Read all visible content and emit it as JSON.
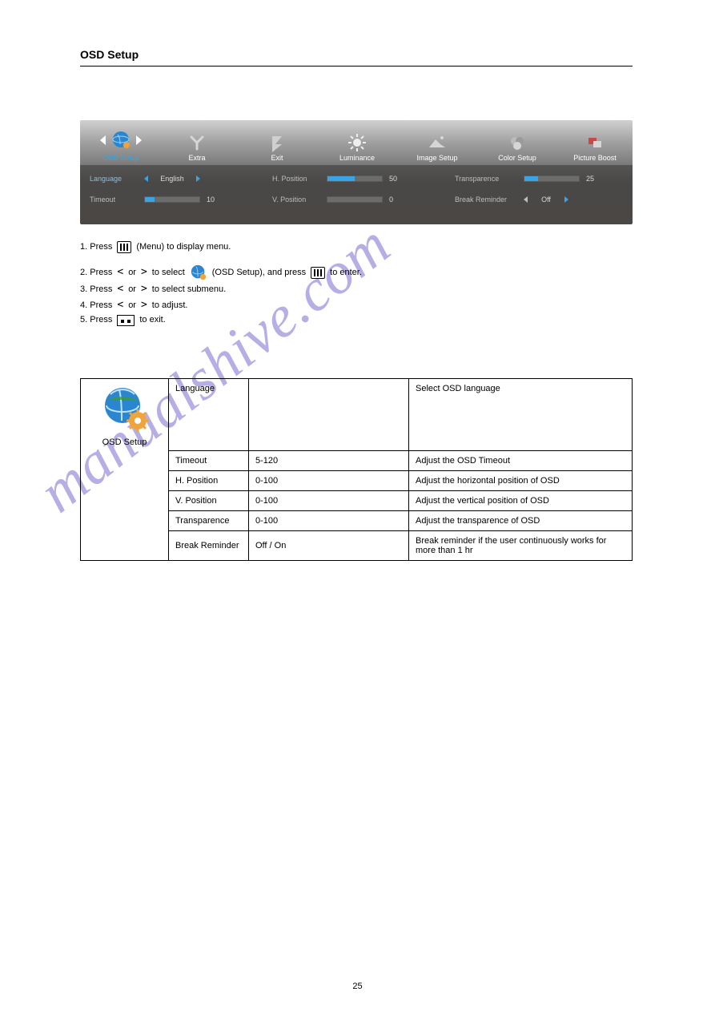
{
  "section_title": "OSD Setup",
  "osd": {
    "tabs": [
      {
        "label": "OSD Setup"
      },
      {
        "label": "Extra"
      },
      {
        "label": "Exit"
      },
      {
        "label": "Luminance"
      },
      {
        "label": "Image Setup"
      },
      {
        "label": "Color Setup"
      },
      {
        "label": "Picture Boost"
      }
    ],
    "language": {
      "label": "Language",
      "value": "English"
    },
    "timeout": {
      "label": "Timeout",
      "value": "10"
    },
    "hpos": {
      "label": "H. Position",
      "value": "50"
    },
    "vpos": {
      "label": "V. Position",
      "value": "0"
    },
    "transp": {
      "label": "Transparence",
      "value": "25"
    },
    "break": {
      "label": "Break Reminder",
      "value": "Off"
    }
  },
  "instructions": {
    "step1_a": "1.    Press",
    "step1_b": "(Menu) to display menu.",
    "step2_a": "2.    Press",
    "step2_or": "or",
    "step2_b": "to select",
    "step2_c": "(OSD Setup), and press",
    "step2_d": "to enter.",
    "step3_a": "3.    Press",
    "step3_b": "to select submenu.",
    "step4_a": "4.    Press",
    "step4_b": "to adjust.",
    "step5_a": "5.    Press",
    "step5_b": "to exit."
  },
  "table": {
    "icon_label": "OSD Setup",
    "rows": [
      {
        "name": "Language",
        "opts": "",
        "desc": "Select OSD language"
      },
      {
        "name": "Timeout",
        "opts": "5-120",
        "desc": "Adjust the OSD Timeout"
      },
      {
        "name": "H. Position",
        "opts": "0-100",
        "desc": "Adjust the horizontal position of OSD"
      },
      {
        "name": "V. Position",
        "opts": "0-100",
        "desc": "Adjust the vertical position of OSD"
      },
      {
        "name": "Transparence",
        "opts": "0-100",
        "desc": "Adjust the transparence of OSD"
      },
      {
        "name": "Break Reminder",
        "opts": "Off / On",
        "desc": "Break reminder if the user continuously works for more than 1 hr"
      }
    ]
  },
  "watermark": "manualshive.com",
  "page_number": "25"
}
